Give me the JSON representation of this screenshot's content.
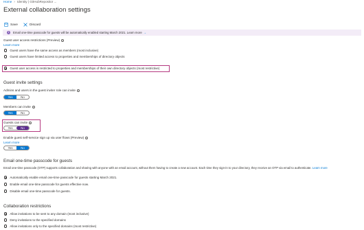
{
  "breadcrumb": {
    "home": "Home",
    "tenant": "Identity | GitHubRepositor ..."
  },
  "page_title": "External collaboration settings",
  "toolbar": {
    "save_label": "Save",
    "discard_label": "Discard"
  },
  "banner": {
    "text": "Email one-time passcode for guests will be automatically enabled starting March 2021. Learn more",
    "arrow": "→"
  },
  "guest_access": {
    "label": "Guest user access restrictions (Preview)",
    "learn_more": "Learn more",
    "options": [
      "Guest users have the same access as members (most inclusive)",
      "Guest users have limited access to properties and memberships of directory objects",
      "Guest user access is restricted to properties and memberships of their own directory objects (most restrictive)"
    ],
    "selected_index": 2
  },
  "invite_settings": {
    "title": "Guest invite settings",
    "admins_label": "Admins and users in the guest inviter role can invite",
    "members_label": "Members can invite",
    "guests_label": "Guests can invite",
    "self_service_label": "Enable guest self-service sign up via user flows (Preview)",
    "learn_more": "Learn more",
    "yes": "Yes",
    "no": "No"
  },
  "otp": {
    "title": "Email one-time passcode for guests",
    "description": "Email one-time passcode (OTP) supports collaboration and sharing with anyone with an email account, without them having to create a new account. Each time they sign-in to your directory, they receive an OTP via email to authenticate.",
    "learn_more": "Learn more",
    "options": [
      "Automatically enable email one-time passcode for guests starting March 2021.",
      "Enable email one-time passcode for guests effective now.",
      "Disable email one-time passcode for guests."
    ],
    "selected_index": 0
  },
  "collab": {
    "title": "Collaboration restrictions",
    "options": [
      "Allow invitations to be sent to any domain (most inclusive)",
      "Deny invitations to the specified domains",
      "Allow invitations only to the specified domains (most restrictive)"
    ],
    "selected_index": 0
  },
  "colors": {
    "accent": "#0078d4",
    "highlight": "#b4377f",
    "toggle_selected_purple": "#5c2d91",
    "banner_bg": "#f3ecf7"
  },
  "info_glyph": "i"
}
